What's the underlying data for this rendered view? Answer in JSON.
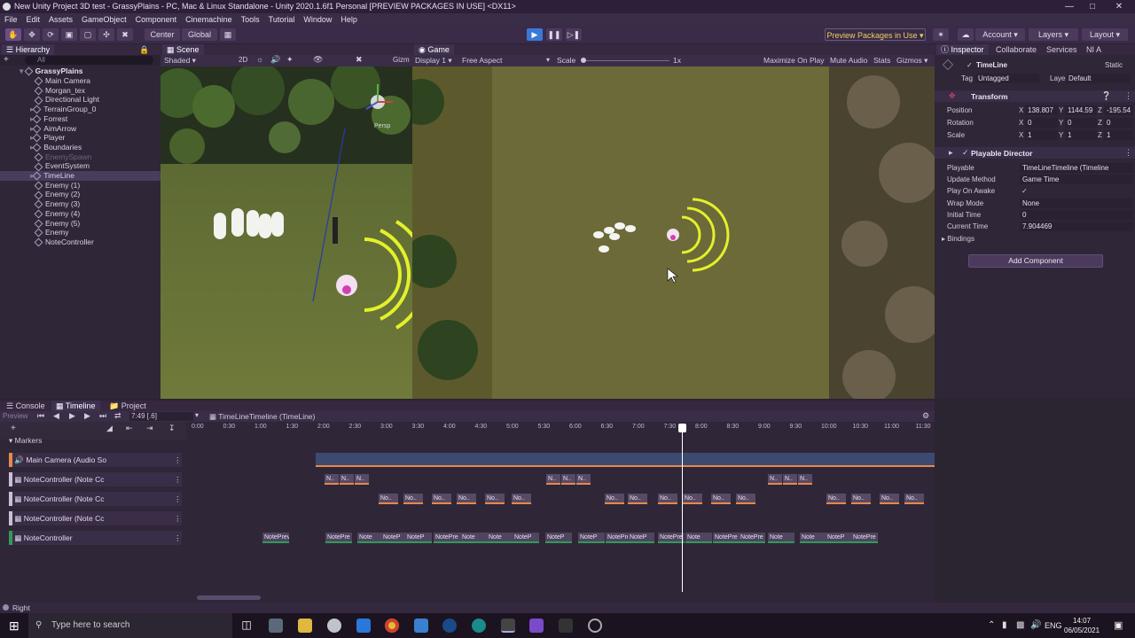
{
  "window": {
    "title": "New Unity Project 3D test - GrassyPlains - PC, Mac & Linux Standalone - Unity 2020.1.6f1 Personal [PREVIEW PACKAGES IN USE] <DX11>"
  },
  "menu": [
    "File",
    "Edit",
    "Assets",
    "GameObject",
    "Component",
    "Cinemachine",
    "Tools",
    "Tutorial",
    "Window",
    "Help"
  ],
  "toolbar": {
    "center": "Center",
    "global": "Global",
    "preview_packages": "Preview Packages in Use",
    "account": "Account",
    "layers": "Layers",
    "layout": "Layout"
  },
  "hierarchy": {
    "tab": "Hierarchy",
    "search": "All",
    "scene": "GrassyPlains",
    "items": [
      "Main Camera",
      "Morgan_tex",
      "Directional Light",
      "TerrainGroup_0",
      "Forrest",
      "AimArrow",
      "Player",
      "Boundaries",
      "EnemySpawn",
      "EventSystem",
      "TimeLine",
      "Enemy (1)",
      "Enemy (2)",
      "Enemy (3)",
      "Enemy (4)",
      "Enemy (5)",
      "Enemy",
      "NoteController"
    ]
  },
  "scene_view": {
    "tab": "Scene",
    "shading": "Shaded",
    "mode_2d": "2D",
    "gizmos": "Gizm",
    "persp": "Persp"
  },
  "game_view": {
    "tab": "Game",
    "display": "Display 1",
    "aspect": "Free Aspect",
    "scale_label": "Scale",
    "scale_value": "1x",
    "maximize": "Maximize On Play",
    "mute": "Mute Audio",
    "stats": "Stats",
    "gizmos": "Gizmos"
  },
  "inspector": {
    "tabs": [
      "Inspector",
      "Collaborate",
      "Services",
      "NI A"
    ],
    "object_name": "TimeLine",
    "static": "Static",
    "tag_label": "Tag",
    "tag": "Untagged",
    "layer_label": "Layer",
    "layer": "Default",
    "transform": {
      "title": "Transform",
      "position_label": "Position",
      "rotation_label": "Rotation",
      "scale_label": "Scale",
      "position": {
        "x": "138.807",
        "y": "1144.59",
        "z": "-195.54"
      },
      "rotation": {
        "x": "0",
        "y": "0",
        "z": "0"
      },
      "scale": {
        "x": "1",
        "y": "1",
        "z": "1"
      }
    },
    "playable_director": {
      "title": "Playable Director",
      "playable_label": "Playable",
      "playable": "TimeLineTimeline (Timeline",
      "update_label": "Update Method",
      "update": "Game Time",
      "awake_label": "Play On Awake",
      "awake": "✓",
      "wrap_label": "Wrap Mode",
      "wrap": "None",
      "initial_label": "Initial Time",
      "initial": "0",
      "current_label": "Current Time",
      "current": "7.904469",
      "bindings": "Bindings"
    },
    "add_component": "Add Component"
  },
  "timeline": {
    "tabs": [
      "Console",
      "Timeline",
      "Project"
    ],
    "preview": "Preview",
    "frame": "7:49 [.6]",
    "asset": "TimeLineTimeline (TimeLine)",
    "markers": "Markers",
    "ticks": [
      "0:00",
      "0:30",
      "1:00",
      "1:30",
      "2:00",
      "2:30",
      "3:00",
      "3:30",
      "4:00",
      "4:30",
      "5:00",
      "5:30",
      "6:00",
      "6:30",
      "7:00",
      "7:30",
      "8:00",
      "8:30",
      "9:00",
      "9:30",
      "10:00",
      "10:30",
      "11:00",
      "11:30"
    ],
    "tracks": [
      "Main Camera (Audio So",
      "NoteController (Note Cc",
      "NoteController (Note Cc",
      "NoteController (Note Cc",
      "NoteController"
    ],
    "track_colors": [
      "#e8884a",
      "#c9c0d6",
      "#c9c0d6",
      "#c9c0d6",
      "#2f9a5a"
    ],
    "clips_row2": [
      "N..",
      "N..",
      "N..",
      "N..",
      "N..",
      "N..",
      "N..",
      "N..",
      "N.."
    ],
    "clips_row3": [
      "No..",
      "No..",
      "No..",
      "No..",
      "No..",
      "No..",
      "No..",
      "No..",
      "No..",
      "No..",
      "No..",
      "No..",
      "No..",
      "No..",
      "No..",
      "No..",
      "No..",
      "No.."
    ],
    "clips_row5": [
      "NotePreview...",
      "NotePre",
      "Note",
      "NoteP",
      "NoteP",
      "NotePre",
      "Note",
      "Note",
      "NoteP",
      "NoteP",
      "NoteP",
      "NotePre",
      "NoteP",
      "NotePre",
      "Note",
      "NotePre",
      "NotePre",
      "Note",
      "Note",
      "NoteP",
      "NotePre"
    ]
  },
  "status": {
    "text": "Right"
  },
  "taskbar": {
    "search_placeholder": "Type here to search",
    "lang": "ENG",
    "time": "14:07",
    "date": "06/05/2021"
  }
}
